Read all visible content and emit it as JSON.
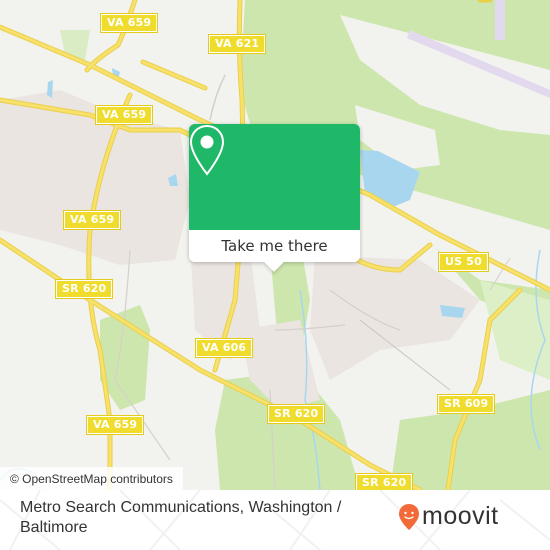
{
  "map": {
    "road_labels": [
      {
        "id": "va659-top",
        "text": "VA 659"
      },
      {
        "id": "va621",
        "text": "VA 621"
      },
      {
        "id": "va659-mid",
        "text": "VA 659"
      },
      {
        "id": "va659-left",
        "text": "VA 659"
      },
      {
        "id": "us50",
        "text": "US 50"
      },
      {
        "id": "sr620-left",
        "text": "SR 620"
      },
      {
        "id": "va606",
        "text": "VA 606"
      },
      {
        "id": "va659-bottom",
        "text": "VA 659"
      },
      {
        "id": "sr609",
        "text": "SR 609"
      },
      {
        "id": "sr620-mid",
        "text": "SR 620"
      },
      {
        "id": "sr620-bottom",
        "text": "SR 620"
      }
    ],
    "colors": {
      "land": "#f2f2ee",
      "forest": "#cde6ad",
      "residential": "#e9e3e0",
      "water": "#a9d6ef",
      "road": "#f7e16b",
      "shield": "#f0dc2c"
    },
    "attribution": "© OpenStreetMap contributors"
  },
  "popup": {
    "icon": "map-pin-icon",
    "button_label": "Take me there",
    "color": "#1fb868"
  },
  "footer": {
    "place_name": "Metro Search Communications, Washington / Baltimore",
    "brand": "moovit",
    "brand_color": "#f26a3a"
  }
}
